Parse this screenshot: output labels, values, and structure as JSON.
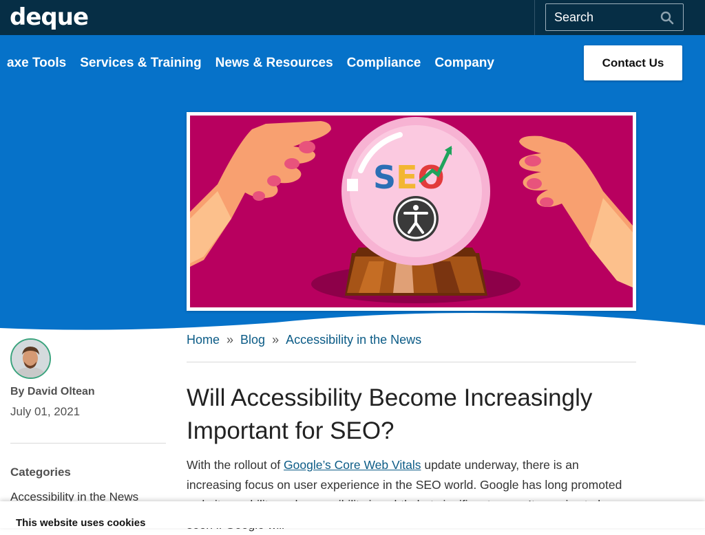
{
  "header": {
    "logo_text": "deque",
    "search_label": "Search"
  },
  "nav": {
    "items": [
      "axe Tools",
      "Services & Training",
      "News & Resources",
      "Compliance",
      "Company"
    ],
    "contact_label": "Contact Us"
  },
  "hero_image": {
    "text": "SEO",
    "colors": {
      "background": "#b8005f",
      "orb": "#f7b3d3",
      "base": "#8a4a1f"
    }
  },
  "sidebar": {
    "author": "By David Oltean",
    "date": "July 01, 2021",
    "categories_title": "Categories",
    "category": "Accessibility in the News"
  },
  "breadcrumb": {
    "home": "Home",
    "sep": "»",
    "blog": "Blog",
    "current": "Accessibility in the News"
  },
  "article": {
    "title": "Will Accessibility Become Increasingly Important for SEO?",
    "body_before_link": "With the rollout of ",
    "body_link": "Google’s Core Web Vitals",
    "body_after_link": " update underway, there is an increasing focus on user experience in the SEO world. Google has long promoted website usability and accessibility in subtle but significant ways. It remains to be seen if Google will"
  },
  "cookie": {
    "title": "This website uses cookies"
  },
  "colors": {
    "topbar": "#062e45",
    "primary_blue": "#0672c9",
    "link": "#0b5b86"
  }
}
